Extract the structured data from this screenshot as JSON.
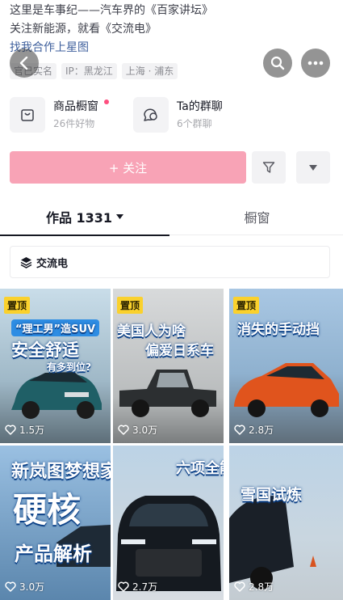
{
  "profile": {
    "bio_line1": "这里是车事纪——汽车界的《百家讲坛》",
    "bio_line2": "关注新能源，就看《交流电》",
    "bio_link": "找我合作上星图",
    "tags": [
      "官已实名",
      "IP：黑龙江",
      "上海 · 浦东"
    ]
  },
  "features": {
    "shop": {
      "title": "商品橱窗",
      "subtitle": "26件好物"
    },
    "group": {
      "title": "Ta的群聊",
      "subtitle": "6个群聊"
    }
  },
  "actions": {
    "follow_label": "+ 关注"
  },
  "tabs": {
    "works_label": "作品 1331",
    "window_label": "橱窗"
  },
  "collection": {
    "label": "交流电"
  },
  "videos": [
    {
      "pin": "置顶",
      "headline1": "“理工男”造SUV",
      "headline2": "安全舒适",
      "headline3": "有多到位?",
      "likes": "1.5万"
    },
    {
      "pin": "置顶",
      "headline1": "美国人为啥",
      "headline2": "偏爱日系车",
      "likes": "3.0万"
    },
    {
      "pin": "置顶",
      "headline1": "消失的手动挡",
      "likes": "2.8万"
    },
    {
      "headline1": "新岚图梦想家",
      "headline2": "硬核",
      "headline3": "产品解析",
      "likes": "3.0万"
    },
    {
      "headline1": "六项全能",
      "headline2": "雪国试炼",
      "likes": "2.7万"
    },
    {
      "likes": "2.8万"
    }
  ],
  "colors": {
    "follow_bg": "#f8a3b6",
    "pin_bg": "#fad12d",
    "link": "#3e5f9c",
    "accent_dot": "#fe4f7f"
  },
  "icons": [
    "back-icon",
    "search-icon",
    "more-icon",
    "shop-bag-icon",
    "chat-bubble-icon",
    "share-icon",
    "dropdown-icon",
    "layers-icon",
    "heart-icon"
  ]
}
